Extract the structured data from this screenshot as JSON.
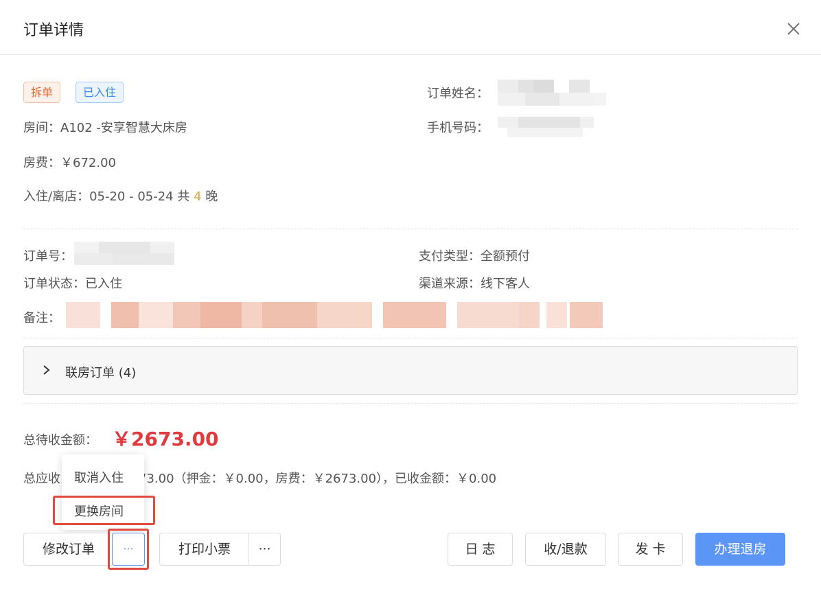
{
  "dialog": {
    "title": "订单详情"
  },
  "tags": {
    "split": "拆单",
    "status": "已入住"
  },
  "room": {
    "label": "房间：",
    "value": "A102 -安享智慧大床房"
  },
  "fee": {
    "label": "房费：",
    "value": "￥672.00"
  },
  "stay": {
    "label": "入住/离店：",
    "dates": "05-20 - 05-24 共 ",
    "nights": "4",
    "unit": " 晚"
  },
  "guest": {
    "name_label": "订单姓名：",
    "phone_label": "手机号码："
  },
  "order": {
    "id_label": "订单号：",
    "status_label": "订单状态：",
    "status_value": "已入住",
    "pay_label": "支付类型：",
    "pay_value": "全额预付",
    "channel_label": "渠道来源：",
    "channel_value": "线下客人",
    "remark_label": "备注："
  },
  "linked": {
    "label": "联房订单 (4)"
  },
  "totals": {
    "due_label": "总待收金额：",
    "due_amount": "￥2673.00",
    "summary_prefix": "总应收",
    "summary_rest": "73.00（押金：￥0.00，房费：￥2673.00），已收金额：￥0.00"
  },
  "dropdown": {
    "items": [
      "取消入住",
      "更换房间"
    ]
  },
  "buttons": {
    "edit": "修改订单",
    "more": "···",
    "print": "打印小票",
    "print_more": "···",
    "log": "日 志",
    "payment": "收/退款",
    "card": "发 卡",
    "checkout": "办理退房"
  },
  "colors": {
    "primary": "#5b95f6",
    "danger": "#e0393e",
    "highlight": "#e04b41",
    "orange": "#e6a23c"
  }
}
